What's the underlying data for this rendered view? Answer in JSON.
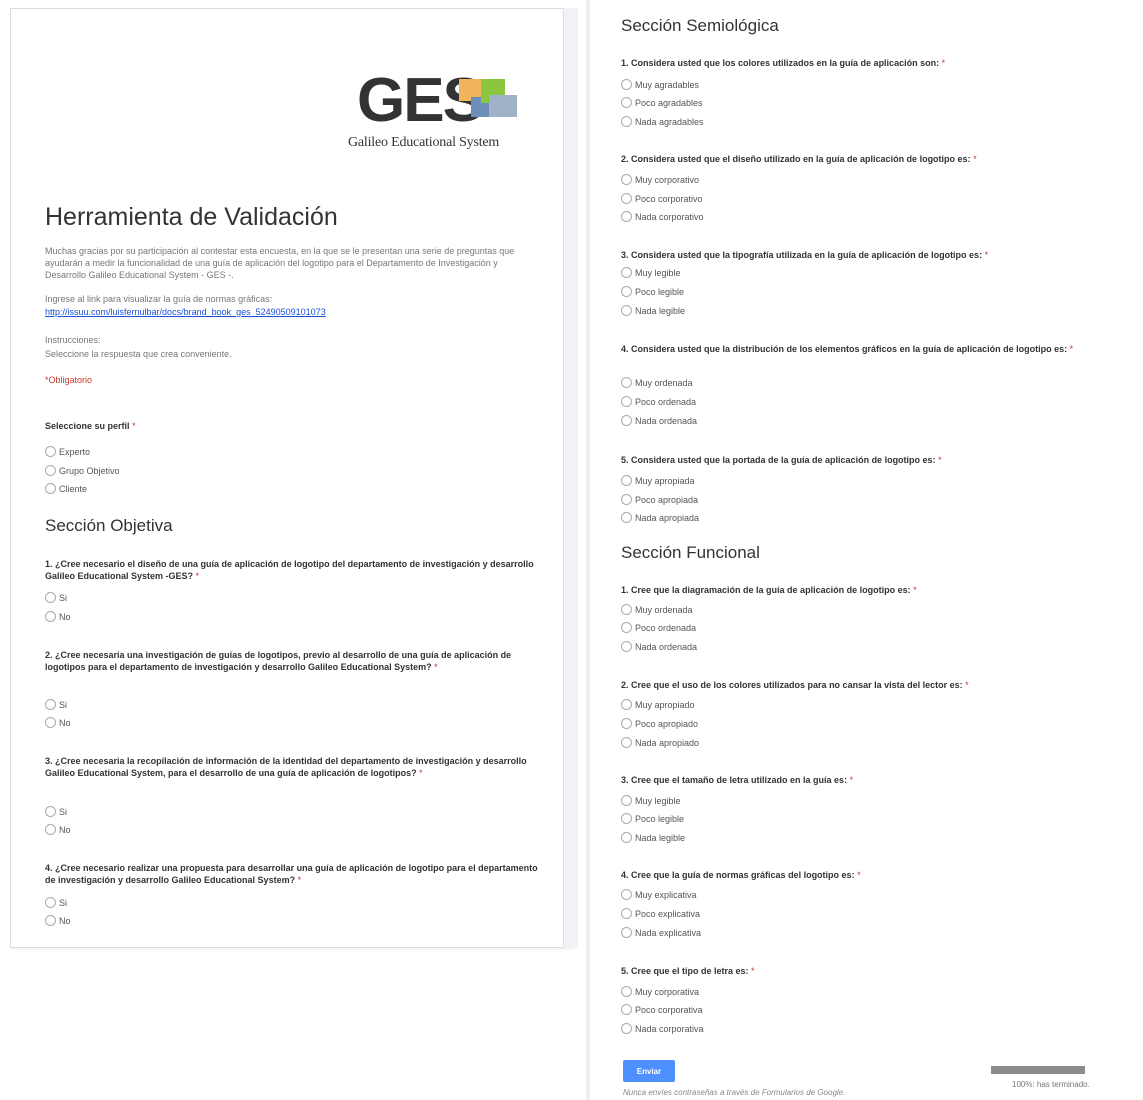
{
  "logo": {
    "brand": "GES",
    "subtitle": "Galileo Educational System"
  },
  "form": {
    "title": "Herramienta de Validación",
    "description": "Muchas gracias por su participación al contestar esta encuesta, en la que se le presentan una serie de preguntas que ayudarán a medir la funcionalidad de una guía de aplicación del logotipo para el Departamento de Investigación y Desarrollo Galileo Educational System - GES -.",
    "link_intro": "Ingrese al link para visualizar la guía de normas gráficas:",
    "link_url": "http://issuu.com/luisfernulbar/docs/brand_book_ges_52490509101073",
    "instructions_label": "Instrucciones:",
    "instructions_text": "Seleccione la respuesta que crea conveniente.",
    "required_note": "*Obligatorio"
  },
  "profile": {
    "question": "Seleccione su perfil",
    "star": "*",
    "options": [
      "Experto",
      "Grupo Objetivo",
      "Cliente"
    ]
  },
  "section_objetiva": {
    "title": "Sección Objetiva",
    "questions": [
      {
        "text": "1. ¿Cree necesario el diseño de una guía de aplicación de logotipo del departamento de investigación y desarrollo Galileo Educational System -GES? ",
        "star": "*",
        "options": [
          "Si",
          "No"
        ]
      },
      {
        "text": "2. ¿Cree necesaria una investigación de guías de logotipos, previo al desarrollo de una guía de aplicación de logotipos para el departamento de investigación y desarrollo Galileo Educational System? ",
        "star": "*",
        "options": [
          "Si",
          "No"
        ]
      },
      {
        "text": "3. ¿Cree necesaria la recopilación de información de la identidad del departamento de investigación y desarrollo Galileo Educational System, para el desarrollo de una guía de aplicación de logotipos? ",
        "star": "*",
        "options": [
          "Si",
          "No"
        ]
      },
      {
        "text": "4. ¿Cree necesario realizar una propuesta para desarrollar una guía de aplicación de logotipo para el departamento de investigación y desarrollo Galileo Educational System? ",
        "star": "*",
        "options": [
          "Si",
          "No"
        ]
      }
    ]
  },
  "section_semiologica": {
    "title": "Sección Semiológica",
    "questions": [
      {
        "text": "1. Considera usted que los colores utilizados en la guía de aplicación son: ",
        "star": "*",
        "options": [
          "Muy agradables",
          "Poco agradables",
          "Nada agradables"
        ]
      },
      {
        "text": "2. Considera usted que el diseño utilizado en la guía de aplicación de logotipo es: ",
        "star": "*",
        "options": [
          "Muy corporativo",
          "Poco corporativo",
          "Nada corporativo"
        ]
      },
      {
        "text": "3. Considera usted que la tipografía utilizada en la guía de aplicación de logotipo es: ",
        "star": "*",
        "options": [
          "Muy legible",
          "Poco legible",
          "Nada legible"
        ]
      },
      {
        "text": "4. Considera usted que la distribución de los elementos gráficos en la guía de aplicación de logotipo es: ",
        "star": "*",
        "options": [
          "Muy ordenada",
          "Poco ordenada",
          "Nada ordenada"
        ]
      },
      {
        "text": "5. Considera usted que la portada de la guía de aplicación de logotipo es: ",
        "star": "*",
        "options": [
          "Muy apropiada",
          "Poco apropiada",
          "Nada apropiada"
        ]
      }
    ]
  },
  "section_funcional": {
    "title": "Sección Funcional",
    "questions": [
      {
        "text": "1. Cree que la diagramación de la guía de aplicación de logotipo es: ",
        "star": "*",
        "options": [
          "Muy ordenada",
          "Poco ordenada",
          "Nada ordenada"
        ]
      },
      {
        "text": "2. Cree que el uso de los colores utilizados para no cansar la vista del lector es: ",
        "star": "*",
        "options": [
          "Muy apropiado",
          "Poco apropiado",
          "Nada apropiado"
        ]
      },
      {
        "text": "3. Cree que el tamaño de letra utilizado en la guía es: ",
        "star": "*",
        "options": [
          "Muy legible",
          "Poco legible",
          "Nada legible"
        ]
      },
      {
        "text": "4. Cree que la guía de normas gráficas del logotipo es: ",
        "star": "*",
        "options": [
          "Muy explicativa",
          "Poco explicativa",
          "Nada explicativa"
        ]
      },
      {
        "text": "5. Cree que el tipo de letra es: ",
        "star": "*",
        "options": [
          "Muy corporativa",
          "Poco corporativa",
          "Nada corporativa"
        ]
      }
    ]
  },
  "footer": {
    "submit_label": "Enviar",
    "progress_fraction": 1.0,
    "progress_text": "100%: has terminado.",
    "note": "Nunca envíes contraseñas a través de Formularios de Google."
  }
}
